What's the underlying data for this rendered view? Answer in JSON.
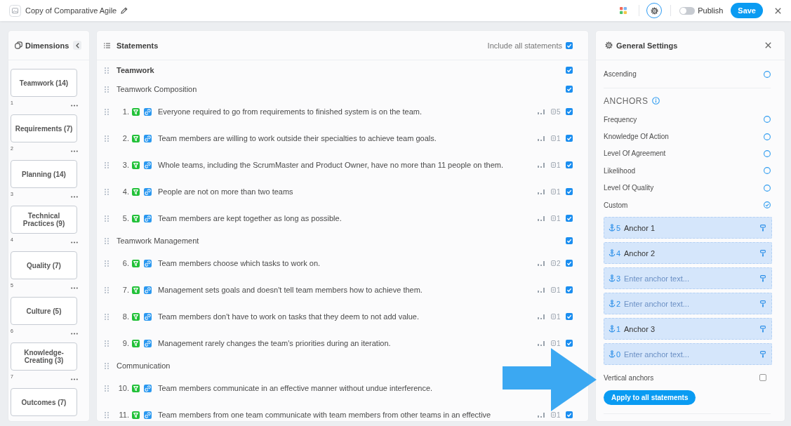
{
  "header": {
    "title": "Copy of Comparative Agile",
    "publish": {
      "label": "Publish",
      "on": false
    },
    "save": "Save"
  },
  "dimensions": {
    "title": "Dimensions",
    "items": [
      {
        "name": "Teamwork (14)",
        "index": "1"
      },
      {
        "name": "Requirements (7)",
        "index": "2"
      },
      {
        "name": "Planning (14)",
        "index": "3"
      },
      {
        "name": "Technical Practices (9)",
        "index": "4"
      },
      {
        "name": "Quality (7)",
        "index": "5"
      },
      {
        "name": "Culture (5)",
        "index": "6"
      },
      {
        "name": "Knowledge-Creating (3)",
        "index": "7"
      },
      {
        "name": "Outcomes (7)"
      }
    ]
  },
  "statements": {
    "title": "Statements",
    "include_all": {
      "label": "Include all statements",
      "checked": true
    },
    "rows": [
      {
        "kind": "dimension",
        "text": "Teamwork",
        "checked": true
      },
      {
        "kind": "group",
        "text": "Teamwork Composition",
        "checked": true
      },
      {
        "kind": "statement",
        "number": "1.",
        "text": "Everyone required to go from requirements to finished system is on the team.",
        "count": "5",
        "checked": true
      },
      {
        "kind": "statement",
        "number": "2.",
        "text": "Team members are willing to work outside their specialties to achieve team goals.",
        "count": "1",
        "checked": true
      },
      {
        "kind": "statement",
        "number": "3.",
        "text": "Whole teams, including the ScrumMaster and Product Owner, have no more than 11 people on them.",
        "count": "1",
        "checked": true
      },
      {
        "kind": "statement",
        "number": "4.",
        "text": "People are not on more than two teams",
        "count": "1",
        "checked": true
      },
      {
        "kind": "statement",
        "number": "5.",
        "text": "Team members are kept together as long as possible.",
        "count": "1",
        "checked": true
      },
      {
        "kind": "group",
        "text": "Teamwork Management",
        "checked": true
      },
      {
        "kind": "statement",
        "number": "6.",
        "text": "Team members choose which tasks to work on.",
        "count": "2",
        "checked": true
      },
      {
        "kind": "statement",
        "number": "7.",
        "text": "Management sets goals and doesn't tell team members how to achieve them.",
        "count": "1",
        "checked": true
      },
      {
        "kind": "statement",
        "number": "8.",
        "text": "Team members don't have to work on tasks that they deem to not add value.",
        "count": "1",
        "checked": true
      },
      {
        "kind": "statement",
        "number": "9.",
        "text": "Management rarely changes the team's priorities during an iteration.",
        "count": "1",
        "checked": true
      },
      {
        "kind": "group",
        "text": "Communication"
      },
      {
        "kind": "statement",
        "number": "10.",
        "text": "Team members communicate in an effective manner without undue interference."
      },
      {
        "kind": "statement",
        "number": "11.",
        "text": "Team members from one team communicate with team members from other teams in an effective",
        "count": "1",
        "checked": true
      }
    ]
  },
  "settings": {
    "title": "General Settings",
    "ascending": {
      "label": "Ascending",
      "checked": false
    },
    "anchors_title": "ANCHORS",
    "anchor_types": [
      {
        "label": "Frequency",
        "selected": false
      },
      {
        "label": "Knowledge Of Action",
        "selected": false
      },
      {
        "label": "Level Of Agreement",
        "selected": false
      },
      {
        "label": "Likelihood",
        "selected": false
      },
      {
        "label": "Level Of Quality",
        "selected": false
      },
      {
        "label": "Custom",
        "selected": true
      }
    ],
    "anchors": [
      {
        "number": "5",
        "value": "Anchor 1"
      },
      {
        "number": "4",
        "value": "Anchor 2"
      },
      {
        "number": "3",
        "placeholder": "Enter anchor text..."
      },
      {
        "number": "2",
        "placeholder": "Enter anchor text..."
      },
      {
        "number": "1",
        "value": "Anchor 3"
      },
      {
        "number": "0",
        "placeholder": "Enter anchor text..."
      }
    ],
    "vertical_anchors": {
      "label": "Vertical anchors",
      "checked": false
    },
    "apply": "Apply to all statements"
  }
}
